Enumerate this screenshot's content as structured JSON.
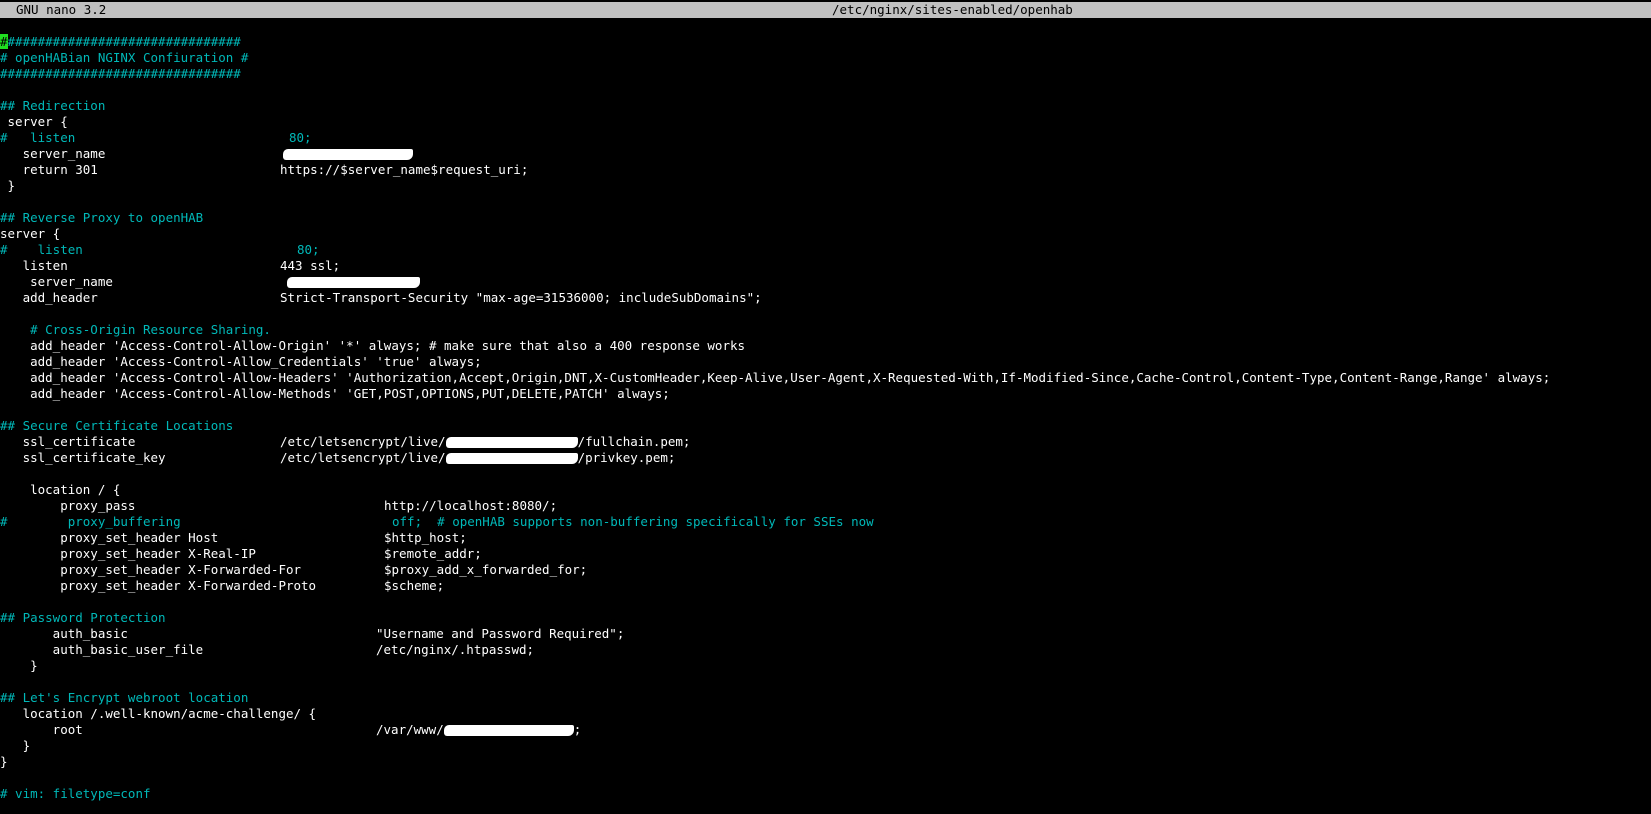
{
  "window": {
    "app": "GNU nano 3.2",
    "file": "/etc/nginx/sites-enabled/openhab"
  },
  "colors": {
    "background": "#000000",
    "titlebar": "#c0c0c0",
    "comment": "#00b8b8",
    "text": "#ffffff",
    "cursor": "#20e020"
  },
  "lines": {
    "l1_cursor": "#",
    "l1_rest": "###############################",
    "l2": "# openHABian NGINX Confiuration #",
    "l3": "################################",
    "l5": "## Redirection",
    "l6": " server {",
    "l7_a": "#   listen",
    "l7_b": "80;",
    "l8_a": "   server_name",
    "l9_a": "   return 301",
    "l9_b": "https://$server_name$request_uri;",
    "l10": " }",
    "l12": "## Reverse Proxy to openHAB",
    "l13": "server {",
    "l14_a": "#    listen",
    "l14_b": "80;",
    "l15_a": "   listen",
    "l15_b": "443 ssl;",
    "l16_a": "    server_name",
    "l17_a": "   add_header",
    "l17_b": "Strict-Transport-Security \"max-age=31536000; includeSubDomains\";",
    "l19": "    # Cross-Origin Resource Sharing.",
    "l20": "    add_header 'Access-Control-Allow-Origin' '*' always; # make sure that also a 400 response works",
    "l21": "    add_header 'Access-Control-Allow_Credentials' 'true' always;",
    "l22": "    add_header 'Access-Control-Allow-Headers' 'Authorization,Accept,Origin,DNT,X-CustomHeader,Keep-Alive,User-Agent,X-Requested-With,If-Modified-Since,Cache-Control,Content-Type,Content-Range,Range' always;",
    "l23": "    add_header 'Access-Control-Allow-Methods' 'GET,POST,OPTIONS,PUT,DELETE,PATCH' always;",
    "l25": "## Secure Certificate Locations",
    "l26_a": "   ssl_certificate",
    "l26_b": "/etc/letsencrypt/live/",
    "l26_c": "/fullchain.pem;",
    "l27_a": "   ssl_certificate_key",
    "l27_b": "/etc/letsencrypt/live/",
    "l27_c": "/privkey.pem;",
    "l29": "    location / {",
    "l30_a": "        proxy_pass",
    "l30_b": "http://localhost:8080/;",
    "l31_a": "#        proxy_buffering",
    "l31_b": "off;  # openHAB supports non-buffering specifically for SSEs now",
    "l32_a": "        proxy_set_header Host",
    "l32_b": "$http_host;",
    "l33_a": "        proxy_set_header X-Real-IP",
    "l33_b": "$remote_addr;",
    "l34_a": "        proxy_set_header X-Forwarded-For",
    "l34_b": "$proxy_add_x_forwarded_for;",
    "l35_a": "        proxy_set_header X-Forwarded-Proto",
    "l35_b": "$scheme;",
    "l37": "## Password Protection",
    "l38_a": "       auth_basic",
    "l38_b": "\"Username and Password Required\";",
    "l39_a": "       auth_basic_user_file",
    "l39_b": "/etc/nginx/.htpasswd;",
    "l40": "    }",
    "l42": "## Let's Encrypt webroot location",
    "l43": "   location /.well-known/acme-challenge/ {",
    "l44_a": "       root",
    "l44_b": "/var/www/",
    "l44_c": ";",
    "l45": "   }",
    "l46": "}",
    "l48": "# vim: filetype=conf"
  }
}
